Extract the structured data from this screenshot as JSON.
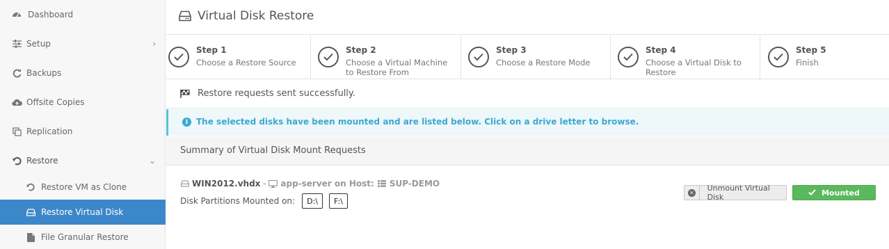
{
  "sidebar": {
    "items": [
      {
        "label": "Dashboard",
        "icon": "dashboard-icon"
      },
      {
        "label": "Setup",
        "icon": "sliders-icon",
        "chevron": "›"
      },
      {
        "label": "Backups",
        "icon": "refresh-icon"
      },
      {
        "label": "Offsite Copies",
        "icon": "cloud-upload-icon"
      },
      {
        "label": "Replication",
        "icon": "clone-icon"
      },
      {
        "label": "Restore",
        "icon": "undo-icon",
        "chevron": "⌄"
      }
    ],
    "sub_items": [
      {
        "label": "Restore VM as Clone",
        "icon": "undo-icon"
      },
      {
        "label": "Restore Virtual Disk",
        "icon": "hdd-icon",
        "active": true
      },
      {
        "label": "File Granular Restore",
        "icon": "file-icon"
      }
    ]
  },
  "header": {
    "title": "Virtual Disk Restore",
    "icon": "hdd-icon"
  },
  "steps": [
    {
      "number": "Step 1",
      "description": "Choose a Restore Source"
    },
    {
      "number": "Step 2",
      "description": "Choose a Virtual Machine to Restore From"
    },
    {
      "number": "Step 3",
      "description": "Choose a Restore Mode"
    },
    {
      "number": "Step 4",
      "description": "Choose a Virtual Disk to Restore"
    },
    {
      "number": "Step 5",
      "description": "Finish"
    }
  ],
  "success_message": "Restore requests sent successfully.",
  "info_message": "The selected disks have been mounted and are listed below. Click on a drive letter to browse.",
  "summary_title": "Summary of Virtual Disk Mount Requests",
  "disk": {
    "filename": "WIN2012.vhdx",
    "separator": " - ",
    "vm": "app-server on Host:",
    "host": "SUP-DEMO",
    "partitions_label": "Disk Partitions Mounted on:",
    "drives": [
      "D:\\",
      "F:\\"
    ],
    "unmount_label": "Unmount Virtual Disk",
    "status_label": "Mounted"
  },
  "colors": {
    "accent": "#3c87c9",
    "info": "#3aa9cf",
    "success": "#5cb85c"
  }
}
